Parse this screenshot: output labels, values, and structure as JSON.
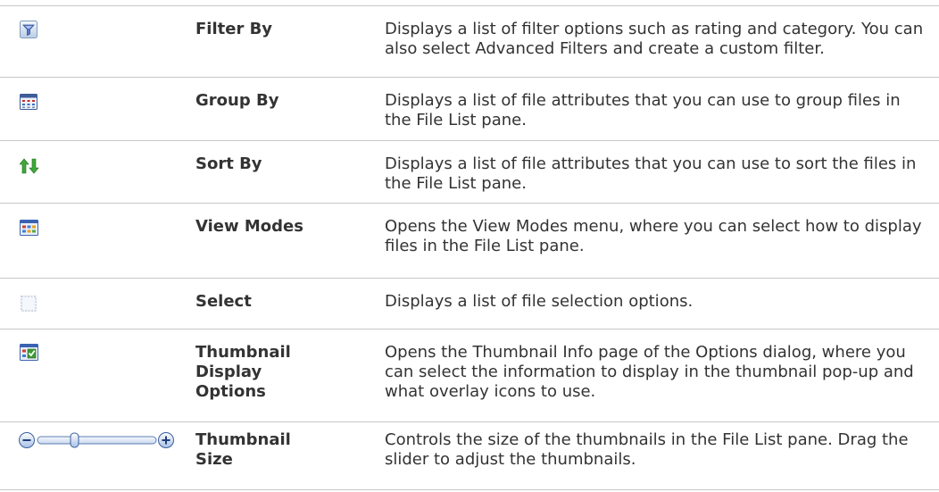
{
  "rows": [
    {
      "icon": "filter-icon",
      "name": "Filter By",
      "description": "Displays a list of filter options such as rating and category. You can also select Advanced Filters and create a custom filter."
    },
    {
      "icon": "group-by-icon",
      "name": "Group By",
      "description": "Displays a list of file attributes that you can use to group files in the File List pane."
    },
    {
      "icon": "sort-arrows-icon",
      "name": "Sort By",
      "description": "Displays a list of file attributes that you can use to sort the files in the File List pane."
    },
    {
      "icon": "view-modes-icon",
      "name": "View Modes",
      "description": "Opens the View Modes menu, where you can select how to display files in the File List pane."
    },
    {
      "icon": "select-icon",
      "name": "Select",
      "description": "Displays a list of file selection options."
    },
    {
      "icon": "thumbnail-options-icon",
      "name": "Thumbnail Display Options",
      "description": "Opens the Thumbnail Info page of the Options dialog, where you can select the information to display in the thumbnail pop-up and what overlay icons to use."
    },
    {
      "icon": "zoom-slider-icon",
      "name": "Thumbnail Size",
      "description": "Controls the size of the thumbnails in the File List pane. Drag the slider to adjust the thumbnails."
    }
  ]
}
